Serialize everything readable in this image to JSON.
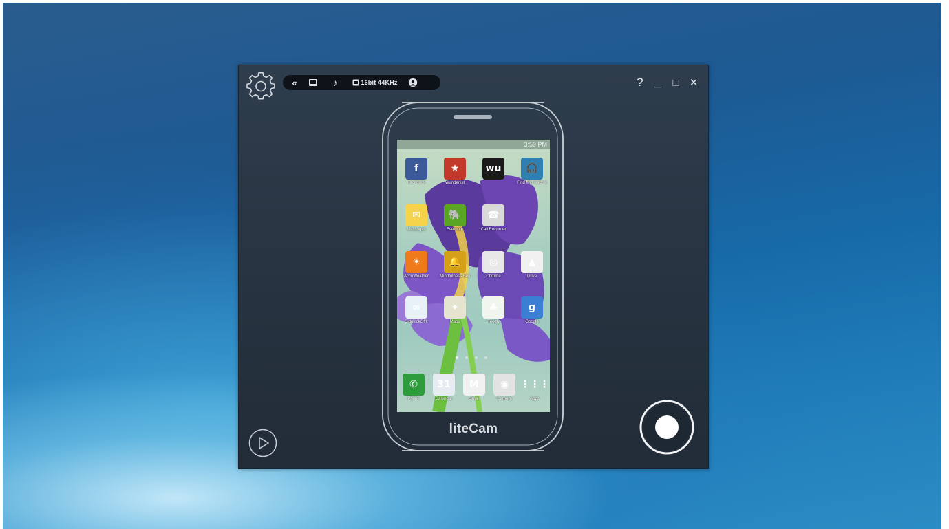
{
  "toolbar": {
    "collapse_glyph": "«",
    "screen_icon": "screen-capture-icon",
    "audio_glyph": "♪",
    "audio_quality": "16bit 44KHz",
    "webcam_icon": "webcam-icon"
  },
  "window_controls": {
    "help": "?",
    "minimize": "_",
    "maximize": "□",
    "close": "✕"
  },
  "phone": {
    "status_time": "3:59 PM",
    "apps": [
      {
        "label": "Facebook",
        "color": "#3b5998",
        "glyph": "f"
      },
      {
        "label": "Wunderlist",
        "color": "#c0392b",
        "glyph": "★"
      },
      {
        "label": "",
        "color": "#1a1a1a",
        "glyph": "wu"
      },
      {
        "label": "Find MyHeadset",
        "color": "#2f7fb0",
        "glyph": "🎧"
      },
      {
        "label": "Messages",
        "color": "#f5d34a",
        "glyph": "✉"
      },
      {
        "label": "Evernote",
        "color": "#5ba525",
        "glyph": "🐘"
      },
      {
        "label": "Call Recorder",
        "color": "#d9d9d9",
        "glyph": "☎"
      },
      {
        "label": "",
        "color": "rgba(0,0,0,0)",
        "glyph": ""
      },
      {
        "label": "AccuWeather",
        "color": "#f07a1a",
        "glyph": "☀"
      },
      {
        "label": "Mindfulness Bell",
        "color": "#d4a017",
        "glyph": "🔔"
      },
      {
        "label": "Chrome",
        "color": "#e8e8e8",
        "glyph": "◎"
      },
      {
        "label": "Drive",
        "color": "#f0f0f0",
        "glyph": "▲"
      },
      {
        "label": "SidekickOfflt",
        "color": "#e9f1f8",
        "glyph": "∞"
      },
      {
        "label": "Maps",
        "color": "#e4e4d0",
        "glyph": "⌖"
      },
      {
        "label": "Feedly",
        "color": "#f0f5ee",
        "glyph": "♣"
      },
      {
        "label": "Google",
        "color": "#3b7fd4",
        "glyph": "g"
      }
    ],
    "dock": [
      {
        "label": "Phone",
        "color": "#2e9b3c",
        "glyph": "✆"
      },
      {
        "label": "Calendar",
        "color": "#e6ecf2",
        "glyph": "31"
      },
      {
        "label": "Gmail",
        "color": "#f1f1f1",
        "glyph": "M"
      },
      {
        "label": "Camera",
        "color": "#e3e3e3",
        "glyph": "◉"
      },
      {
        "label": "Apps",
        "color": "rgba(0,0,0,0)",
        "glyph": "⋮⋮⋮"
      }
    ]
  },
  "brand": "liteCam",
  "icons": {
    "settings": "gear-icon",
    "play": "play-icon",
    "record": "record-icon"
  }
}
